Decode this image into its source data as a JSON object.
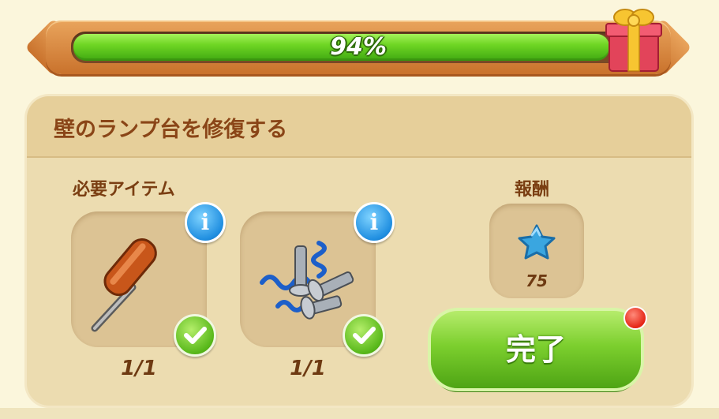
{
  "progress": {
    "label": "94%",
    "fraction": 0.94,
    "bar_color": "#6fd624"
  },
  "gift_icon": "gift-box-icon",
  "task": {
    "title": "壁のランプ台を修復する",
    "required_label": "必要アイテム",
    "reward_label": "報酬",
    "items": [
      {
        "name": "screwdriver",
        "icon": "screwdriver-icon",
        "count": "1/1",
        "completed": true
      },
      {
        "name": "bolts-and-springs",
        "icon": "bolts-springs-icon",
        "count": "1/1",
        "completed": true
      }
    ],
    "reward": {
      "icon": "blue-star-icon",
      "value": "75"
    },
    "complete_button": "完了"
  },
  "colors": {
    "title_brown": "#8a4517",
    "panel_bg": "#ecdcb0",
    "button_green": "#7ccf2e",
    "info_blue": "#1f8ee0",
    "notification_red": "#e52616"
  }
}
